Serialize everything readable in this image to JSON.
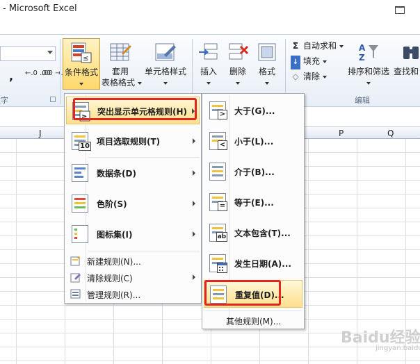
{
  "window": {
    "title": "- Microsoft Excel"
  },
  "ribbon": {
    "number_group_label": "数字",
    "number_comma": ",",
    "inc_decimal": "←.0 .00",
    "dec_decimal": ".00 →.0",
    "conditional_format": {
      "label": "条件格式",
      "caret": "▾"
    },
    "format_as_table": {
      "line1": "套用",
      "line2": "表格格式"
    },
    "cell_styles": {
      "label": "单元格样式"
    },
    "insert": {
      "label": "插入"
    },
    "delete": {
      "label": "删除"
    },
    "format": {
      "label": "格式"
    },
    "autosum": {
      "label": "自动求和"
    },
    "fill": {
      "label": "填充"
    },
    "clear": {
      "label": "清除"
    },
    "sort_filter": {
      "label": "排序和筛选"
    },
    "find_select": {
      "label": "查找和"
    },
    "editing_group_label": "编辑"
  },
  "columns": {
    "j": "J",
    "p": "P",
    "q": "Q"
  },
  "cf_menu": {
    "items": [
      {
        "label": "突出显示单元格规则(H)"
      },
      {
        "label": "项目选取规则(T)"
      },
      {
        "label": "数据条(D)"
      },
      {
        "label": "色阶(S)"
      },
      {
        "label": "图标集(I)"
      }
    ],
    "small_items": [
      {
        "label": "新建规则(N)..."
      },
      {
        "label": "清除规则(C)"
      },
      {
        "label": "管理规则(R)..."
      }
    ]
  },
  "sub_menu": {
    "items": [
      {
        "label": "大于(G)..."
      },
      {
        "label": "小于(L)..."
      },
      {
        "label": "介于(B)..."
      },
      {
        "label": "等于(E)..."
      },
      {
        "label": "文本包含(T)..."
      },
      {
        "label": "发生日期(A)..."
      },
      {
        "label": "重复值(D)..."
      }
    ],
    "more": "其他规则(M)..."
  },
  "watermark": {
    "brand": "Baidu经验",
    "url": "jingyan.baidu.com"
  },
  "colors": {
    "highlight": "#ffe08c",
    "annotation_red": "#e0261f",
    "ribbon_bg": "#e8eef7"
  }
}
